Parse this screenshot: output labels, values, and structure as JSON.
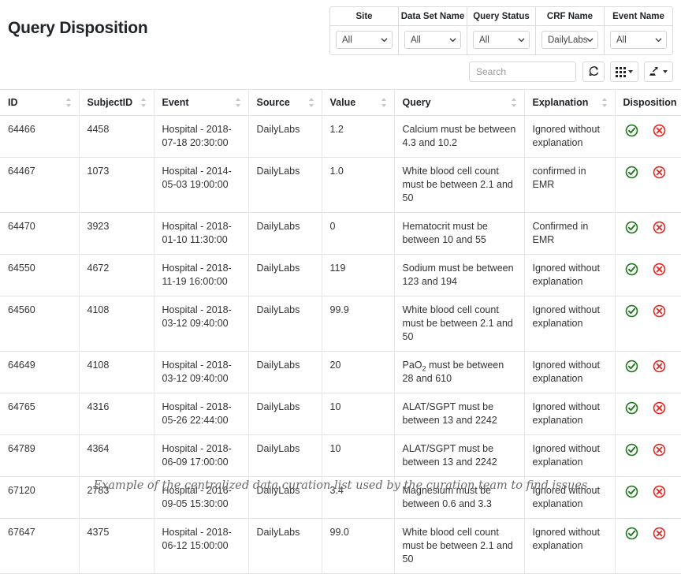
{
  "header": {
    "title": "Query Disposition"
  },
  "filters": [
    {
      "label": "Site",
      "value": "All"
    },
    {
      "label": "Data Set Name",
      "value": "All"
    },
    {
      "label": "Query Status",
      "value": "All"
    },
    {
      "label": "CRF Name",
      "value": "DailyLabs"
    },
    {
      "label": "Event Name",
      "value": "All"
    }
  ],
  "toolbar": {
    "search_placeholder": "Search",
    "search_value": "",
    "refresh_icon": "refresh-icon",
    "columns_icon": "grid-columns-icon",
    "export_icon": "export-icon"
  },
  "table": {
    "columns": [
      {
        "label": "ID",
        "sortable": true
      },
      {
        "label": "SubjectID",
        "sortable": true
      },
      {
        "label": "Event",
        "sortable": true
      },
      {
        "label": "Source",
        "sortable": true
      },
      {
        "label": "Value",
        "sortable": true
      },
      {
        "label": "Query",
        "sortable": true
      },
      {
        "label": "Explanation",
        "sortable": true
      },
      {
        "label": "Disposition",
        "sortable": false
      }
    ],
    "rows": [
      {
        "id": "64466",
        "subject_id": "4458",
        "event": "Hospital - 2018-07-18 20:30:00",
        "source": "DailyLabs",
        "value": "1.2",
        "query": "Calcium must be between 4.3 and 10.2",
        "explanation": "Ignored without explanation"
      },
      {
        "id": "64467",
        "subject_id": "1073",
        "event": "Hospital - 2014-05-03 19:00:00",
        "source": "DailyLabs",
        "value": "1.0",
        "query": "White blood cell count must be between 2.1 and 50",
        "explanation": "confirmed in EMR"
      },
      {
        "id": "64470",
        "subject_id": "3923",
        "event": "Hospital - 2018-01-10 11:30:00",
        "source": "DailyLabs",
        "value": "0",
        "query": "Hematocrit must be between 10 and 55",
        "explanation": "Confirmed in EMR"
      },
      {
        "id": "64550",
        "subject_id": "4672",
        "event": "Hospital - 2018-11-19 16:00:00",
        "source": "DailyLabs",
        "value": "119",
        "query": "Sodium must be between 123 and 194",
        "explanation": "Ignored without explanation"
      },
      {
        "id": "64560",
        "subject_id": "4108",
        "event": "Hospital - 2018-03-12 09:40:00",
        "source": "DailyLabs",
        "value": "99.9",
        "query": "White blood cell count must be between 2.1 and 50",
        "explanation": "Ignored without explanation"
      },
      {
        "id": "64649",
        "subject_id": "4108",
        "event": "Hospital - 2018-03-12 09:40:00",
        "source": "DailyLabs",
        "value": "20",
        "query": "PaO2 must be between 28 and 610",
        "query_html": "PaO<sub>2</sub> must be between 28 and 610",
        "explanation": "Ignored without explanation"
      },
      {
        "id": "64765",
        "subject_id": "4316",
        "event": "Hospital - 2018-05-26 22:44:00",
        "source": "DailyLabs",
        "value": "10",
        "query": "ALAT/SGPT must be between 13 and 2242",
        "explanation": "Ignored without explanation"
      },
      {
        "id": "64789",
        "subject_id": "4364",
        "event": "Hospital - 2018-06-09 17:00:00",
        "source": "DailyLabs",
        "value": "10",
        "query": "ALAT/SGPT must be between 13 and 2242",
        "explanation": "Ignored without explanation"
      },
      {
        "id": "67120",
        "subject_id": "2783",
        "event": "Hospital - 2016-09-05 15:30:00",
        "source": "DailyLabs",
        "value": "3.4",
        "query": "Magnesium must be between 0.6 and 3.3",
        "explanation": "Ignored without explanation"
      },
      {
        "id": "67647",
        "subject_id": "4375",
        "event": "Hospital - 2018-06-12 15:00:00",
        "source": "DailyLabs",
        "value": "99.0",
        "query": "White blood cell count must be between 2.1 and 50",
        "explanation": "Ignored without explanation"
      }
    ],
    "disposition_actions": {
      "accept_icon": "check-circle-icon",
      "reject_icon": "x-circle-icon"
    }
  },
  "caption": {
    "text": "Example of the centralized data curation list used by the curation team to find issues"
  },
  "colors": {
    "accept_green": "#1a7a1a",
    "reject_red": "#e8241f",
    "border": "#dddddd",
    "text": "#212529",
    "muted": "#6b6b6b"
  }
}
